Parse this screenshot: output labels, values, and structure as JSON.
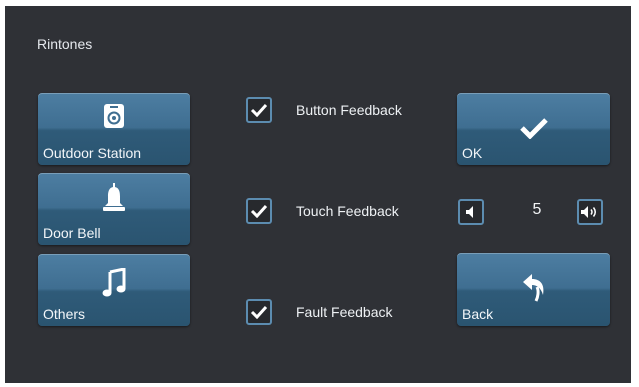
{
  "header": {
    "title": "Rintones"
  },
  "ringtone_buttons": [
    {
      "label": "Outdoor Station",
      "icon": "intercom-speaker-icon"
    },
    {
      "label": "Door Bell",
      "icon": "bell-icon"
    },
    {
      "label": "Others",
      "icon": "music-note-icon"
    }
  ],
  "feedback_options": [
    {
      "label": "Button Feedback",
      "checked": true
    },
    {
      "label": "Touch Feedback",
      "checked": true
    },
    {
      "label": "Fault Feedback",
      "checked": true
    }
  ],
  "volume": {
    "value": "5",
    "down_icon": "volume-down-icon",
    "up_icon": "volume-up-icon"
  },
  "actions": {
    "ok_label": "OK",
    "ok_icon": "checkmark-icon",
    "back_label": "Back",
    "back_icon": "back-arrow-icon"
  },
  "colors": {
    "background": "#2f3136",
    "button": "#3f6e91",
    "checkbox_border": "#5c8cb0"
  }
}
